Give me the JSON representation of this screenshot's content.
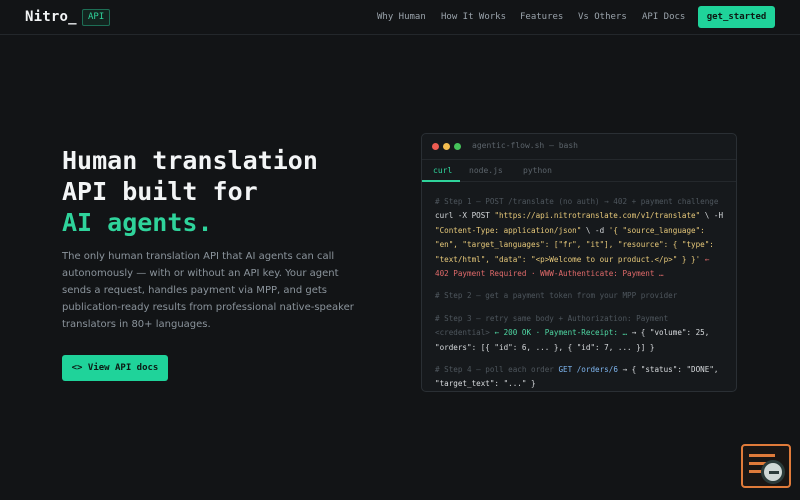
{
  "nav": {
    "logo": "Nitro_",
    "badge": "API",
    "links": [
      "Why Human",
      "How It Works",
      "Features",
      "Vs Others",
      "API Docs"
    ],
    "cta": "get_started"
  },
  "hero": {
    "title_line1": "Human translation",
    "title_line2": "API built for",
    "title_accent": "AI agents.",
    "description": "The only human translation API that AI agents can call autonomously — with or without an API key. Your agent sends a request, handles payment via MPP, and gets publication-ready results from professional native-speaker translators in 80+ languages.",
    "button": "<> View API docs"
  },
  "terminal": {
    "title": "agentic-flow.sh — bash",
    "tabs": [
      "curl",
      "node.js",
      "python"
    ],
    "active_tab": "curl",
    "step1_comment": "# Step 1 — POST /translate (no auth) → 402 + payment challenge",
    "step1_cmd_a": "curl -X POST ",
    "step1_url": "\"https://api.nitrotranslate.com/v1/translate\"",
    "step1_cmd_b": " \\ -H ",
    "step1_header": "\"Content-Type: application/json\"",
    "step1_cmd_c": " \\ -d ",
    "step1_body": "'{ \"source_language\": \"en\", \"target_languages\": [\"fr\", \"it\"], \"resource\": { \"type\": \"text/html\", \"data\": \"<p>Welcome to our product.</p>\" } }'",
    "step1_result": " ← 402 Payment Required · WWW-Authenticate: Payment …",
    "step2_comment": "# Step 2 — get a payment token from your MPP provider",
    "step3_comment": "# Step 3 — retry same body + Authorization: Payment <credential>",
    "step3_result_ok": " ← 200 OK · Payment-Receipt: …",
    "step3_result": " → { \"volume\": 25, \"orders\": [{ \"id\": 6, ... }, { \"id\": 7, ... }] }",
    "step4_comment": "# Step 4 — poll each order ",
    "step4_cmd": "GET /orders/6",
    "step4_result": " → { \"status\": \"DONE\", \"target_text\": \"...\" }"
  },
  "icons": {
    "corner_widget": "search-list-icon"
  },
  "colors": {
    "accent": "#1fd39a",
    "background": "#121416"
  }
}
